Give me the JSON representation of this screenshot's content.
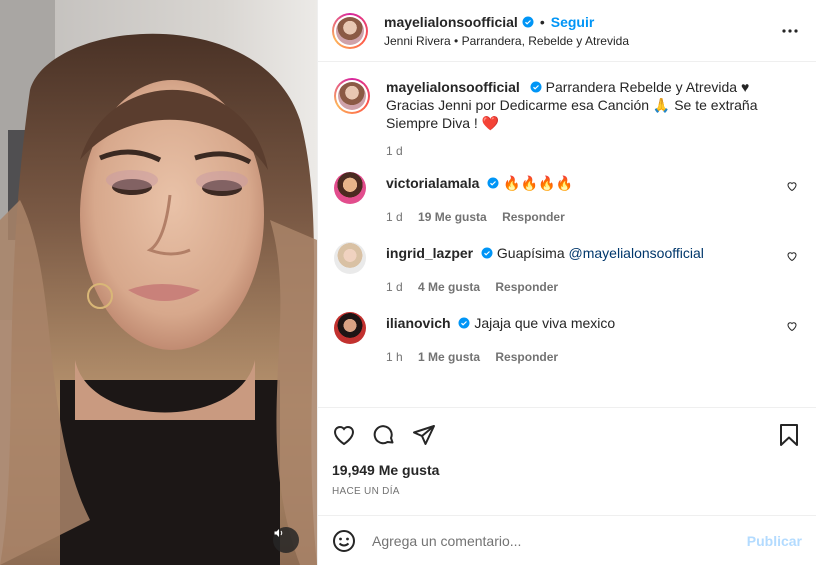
{
  "media": {
    "sound_icon": "speaker-icon"
  },
  "header": {
    "username": "mayelialonsoofficial",
    "separator": "•",
    "follow_label": "Seguir",
    "subtitle": "Jenni Rivera • Parrandera, Rebelde y Atrevida",
    "more_icon": "more-icon"
  },
  "caption": {
    "username": "mayelialonsoofficial",
    "text": " Parrandera Rebelde y Atrevida ♥ Gracias Jenni por Dedicarme esa Canción 🙏 Se te extraña Siempre Diva ! ❤️",
    "time": "1 d"
  },
  "comments": [
    {
      "username": "victorialamala",
      "text": "🔥🔥🔥🔥",
      "time": "1 d",
      "likes": "19 Me gusta",
      "reply": "Responder"
    },
    {
      "username": "ingrid_lazper",
      "text": "Guapísima ",
      "mention": "@mayelialonsoofficial",
      "time": "1 d",
      "likes": "4 Me gusta",
      "reply": "Responder"
    },
    {
      "username": "ilianovich",
      "text": "Jajaja que viva mexico",
      "time": "1 h",
      "likes": "1 Me gusta",
      "reply": "Responder"
    }
  ],
  "actions": {
    "likes": "19,949 Me gusta",
    "ago": "HACE UN DÍA"
  },
  "add_comment": {
    "placeholder": "Agrega un comentario...",
    "publish_label": "Publicar"
  },
  "colors": {
    "accent": "#0095f6",
    "publish_disabled": "#b3dbff",
    "muted": "#737373",
    "like_red": "#ed4956"
  }
}
